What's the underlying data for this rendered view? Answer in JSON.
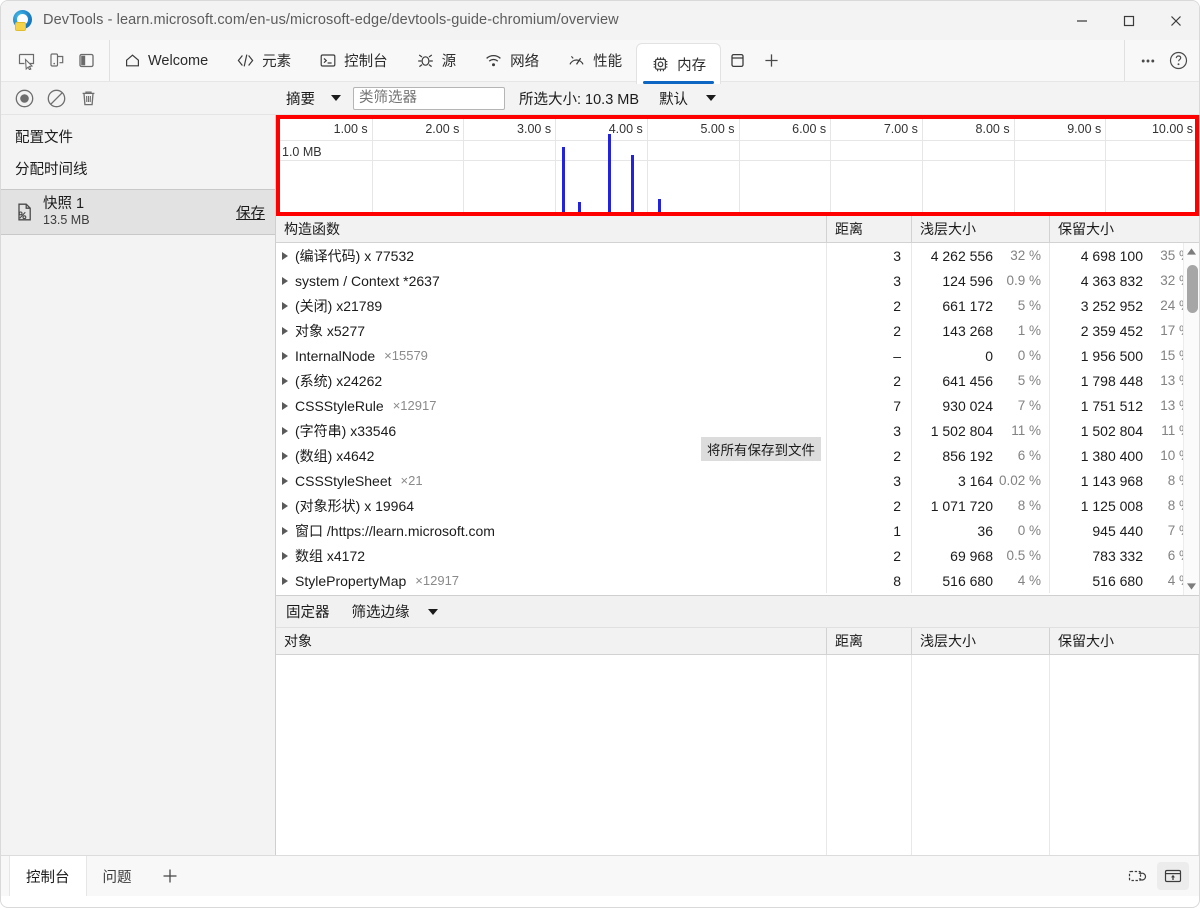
{
  "window": {
    "title": "DevTools - learn.microsoft.com/en-us/microsoft-edge/devtools-guide-chromium/overview",
    "logo_name": "edge-devtools-logo",
    "minimize_label": "—",
    "maximize_label": "☐",
    "close_label": "✕"
  },
  "tabstrip": {
    "tools": [
      {
        "name": "inspect-element-icon",
        "label": "Inspect element"
      },
      {
        "name": "device-emulation-icon",
        "label": "Toggle device emulation"
      },
      {
        "name": "dock-side-icon",
        "label": "Dock side"
      }
    ],
    "tabs": [
      {
        "label": "Welcome",
        "icon": "home-icon",
        "active": false
      },
      {
        "label": "元素",
        "icon": "code-brackets-icon",
        "active": false
      },
      {
        "label": "控制台",
        "icon": "console-icon",
        "active": false
      },
      {
        "label": "源",
        "icon": "sources-icon",
        "active": false
      },
      {
        "label": "网络",
        "icon": "network-icon",
        "active": false
      },
      {
        "label": "性能",
        "icon": "performance-icon",
        "active": false
      },
      {
        "label": "内存",
        "icon": "memory-icon",
        "active": true
      }
    ],
    "application_icon": "application-icon",
    "add_tab_icon": "plus-icon",
    "more_tools_icon": "ellipsis-icon",
    "help_icon": "question-mark-icon"
  },
  "panel_toolbar": {
    "record_icon": "record-circle-icon",
    "clear_icon": "no-entry-icon",
    "trash_icon": "trash-icon",
    "view_select": "摘要",
    "filter_placeholder": "类筛选器",
    "filter_value": "",
    "selected_size_label": "所选大小: 10.3 MB",
    "base_select": "默认"
  },
  "sidebar": {
    "profiles_heading": "配置文件",
    "allocation_timeline": "分配时间线",
    "snapshot": {
      "icon": "snapshot-percent-icon",
      "title": "快照 1",
      "size": "13.5 MB",
      "save_label": "保存"
    }
  },
  "chart_data": {
    "type": "bar",
    "title": "",
    "xlabel": "",
    "ylabel": "1.0 MB",
    "xtick_labels": [
      "1.00 s",
      "2.00 s",
      "3.00 s",
      "4.00 s",
      "5.00 s",
      "6.00 s",
      "7.00 s",
      "8.00 s",
      "9.00 s",
      "10.00 s"
    ],
    "xlim": [
      0,
      10
    ],
    "ylim": [
      0,
      1.6
    ],
    "grid": true,
    "highlight_border_color": "#ff0000",
    "bar_color": "#2323dd",
    "series": [
      {
        "name": "allocation",
        "x": [
          3.08,
          3.25,
          3.58,
          3.83,
          4.12
        ],
        "values": [
          1.12,
          0.17,
          1.35,
          0.98,
          0.22
        ]
      }
    ]
  },
  "constructors_table": {
    "columns": [
      "构造函数",
      "距离",
      "浅层大小",
      "保留大小"
    ],
    "rows": [
      {
        "name": "(编译代码) x 77532",
        "count": "",
        "distance": "3",
        "shallow": "4 262 556",
        "shallow_pct": "32 %",
        "retained": "4 698 100",
        "retained_pct": "35 %"
      },
      {
        "name": "system / Context *2637",
        "count": "",
        "distance": "3",
        "shallow": "124 596",
        "shallow_pct": "0.9 %",
        "retained": "4 363 832",
        "retained_pct": "32 %"
      },
      {
        "name": "(关闭) x21789",
        "count": "",
        "distance": "2",
        "shallow": "661 172",
        "shallow_pct": "5 %",
        "retained": "3 252 952",
        "retained_pct": "24 %"
      },
      {
        "name": "对象 x5277",
        "count": "",
        "distance": "2",
        "shallow": "143 268",
        "shallow_pct": "1 %",
        "retained": "2 359 452",
        "retained_pct": "17 %"
      },
      {
        "name": "InternalNode",
        "count": "×15579",
        "distance": "–",
        "shallow": "0",
        "shallow_pct": "0 %",
        "retained": "1 956 500",
        "retained_pct": "15 %"
      },
      {
        "name": "(系统) x24262",
        "count": "",
        "distance": "2",
        "shallow": "641 456",
        "shallow_pct": "5 %",
        "retained": "1 798 448",
        "retained_pct": "13 %"
      },
      {
        "name": "CSSStyleRule",
        "count": "×12917",
        "distance": "7",
        "shallow": "930 024",
        "shallow_pct": "7 %",
        "retained": "1 751 512",
        "retained_pct": "13 %"
      },
      {
        "name": "(字符串) x33546",
        "count": "",
        "distance": "3",
        "shallow": "1 502 804",
        "shallow_pct": "11 %",
        "retained": "1 502 804",
        "retained_pct": "11 %"
      },
      {
        "name": "(数组) x4642",
        "count": "",
        "distance": "2",
        "shallow": "856 192",
        "shallow_pct": "6 %",
        "retained": "1 380 400",
        "retained_pct": "10 %"
      },
      {
        "name": "CSSStyleSheet",
        "count": "×21",
        "distance": "3",
        "shallow": "3 164",
        "shallow_pct": "0.02 %",
        "retained": "1 143 968",
        "retained_pct": "8 %"
      },
      {
        "name": "(对象形状) x 19964",
        "count": "",
        "distance": "2",
        "shallow": "1 071 720",
        "shallow_pct": "8 %",
        "retained": "1 125 008",
        "retained_pct": "8 %"
      },
      {
        "name": "窗口 /https://learn.microsoft.com",
        "count": "",
        "distance": "1",
        "shallow": "36",
        "shallow_pct": "0 %",
        "retained": "945 440",
        "retained_pct": "7 %"
      },
      {
        "name": "数组 x4172",
        "count": "",
        "distance": "2",
        "shallow": "69 968",
        "shallow_pct": "0.5 %",
        "retained": "783 332",
        "retained_pct": "6 %"
      },
      {
        "name": "StylePropertyMap",
        "count": "×12917",
        "distance": "8",
        "shallow": "516 680",
        "shallow_pct": "4 %",
        "retained": "516 680",
        "retained_pct": "4 %"
      }
    ],
    "tooltip": "将所有保存到文件"
  },
  "retainers": {
    "title": "固定器",
    "filter_label": "筛选边缘",
    "columns": [
      "对象",
      "距离",
      "浅层大小",
      "保留大小"
    ],
    "rows": []
  },
  "drawer": {
    "tabs": [
      {
        "label": "控制台",
        "active": true
      },
      {
        "label": "问题",
        "active": false
      }
    ],
    "add_icon": "plus-icon",
    "right_icons": [
      {
        "name": "restore-drawer-icon"
      },
      {
        "name": "close-drawer-icon"
      }
    ]
  }
}
